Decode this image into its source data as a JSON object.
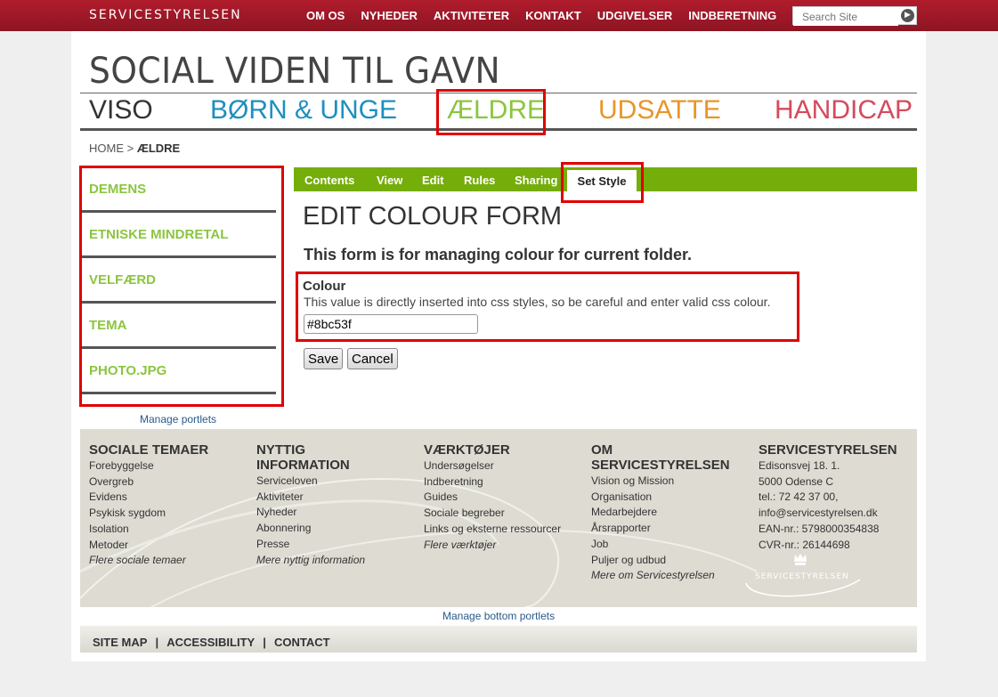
{
  "topbar": {
    "brand": "SERVICESTYRELSEN",
    "nav": [
      "OM OS",
      "NYHEDER",
      "AKTIVITETER",
      "KONTAKT",
      "UDGIVELSER",
      "INDBERETNING"
    ],
    "search_placeholder": "Search Site"
  },
  "site_title": "SOCIAL VIDEN TIL GAVN",
  "sections": [
    {
      "label": "VISO",
      "color": "#333333"
    },
    {
      "label": "BØRN & UNGE",
      "color": "#1e8fbf"
    },
    {
      "label": "ÆLDRE",
      "color": "#8bc53f"
    },
    {
      "label": "UDSATTE",
      "color": "#e8962a"
    },
    {
      "label": "HANDICAP",
      "color": "#d64a5c"
    }
  ],
  "breadcrumb": {
    "home": "HOME",
    "sep": ">",
    "current": "ÆLDRE"
  },
  "sidebar": {
    "items": [
      "DEMENS",
      "ETNISKE MINDRETAL",
      "VELFÆRD",
      "TEMA",
      "PHOTO.JPG"
    ],
    "manage": "Manage portlets"
  },
  "tabs": [
    "Contents",
    "View",
    "Edit",
    "Rules",
    "Sharing"
  ],
  "active_tab": "Set Style",
  "form": {
    "title": "EDIT COLOUR FORM",
    "description": "This form is for managing colour for current folder.",
    "field_label": "Colour",
    "field_help": "This value is directly inserted into css styles, so be careful and enter valid css colour.",
    "field_value": "#8bc53f",
    "save": "Save",
    "cancel": "Cancel"
  },
  "footer": {
    "columns": [
      {
        "title": "SOCIALE TEMAER",
        "items": [
          "Forebyggelse",
          "Overgreb",
          "Evidens",
          "Psykisk sygdom",
          "Isolation",
          "Metoder"
        ],
        "more": "Flere sociale temaer"
      },
      {
        "title": "NYTTIG INFORMATION",
        "items": [
          "Serviceloven",
          "Aktiviteter",
          "Nyheder",
          "Abonnering",
          "Presse"
        ],
        "more": "Mere nyttig information"
      },
      {
        "title": "VÆRKTØJER",
        "items": [
          "Undersøgelser",
          "Indberetning",
          "Guides",
          "Sociale begreber",
          "Links og eksterne ressourcer"
        ],
        "more": "Flere værktøjer"
      },
      {
        "title": "OM SERVICESTYRELSEN",
        "items": [
          "Vision og Mission",
          "Organisation",
          "Medarbejdere",
          "Årsrapporter",
          "Job",
          "Puljer og udbud"
        ],
        "more": "Mere om Servicestyrelsen"
      },
      {
        "title": "SERVICESTYRELSEN",
        "items": [
          "Edisonsvej 18. 1.",
          "5000 Odense C",
          "tel.: 72 42 37 00,",
          "info@servicestyrelsen.dk",
          "EAN-nr.: 5798000354838",
          "CVR-nr.: 26144698"
        ],
        "more": ""
      }
    ],
    "logo_text": "SERVICESTYRELSEN",
    "manage": "Manage bottom portlets"
  },
  "bottom_links": [
    "SITE MAP",
    "ACCESSIBILITY",
    "CONTACT"
  ],
  "bottom_sep": "|",
  "colors": {
    "topbar": "#a01a28",
    "green": "#75ad0a",
    "highlight": "#e00000"
  }
}
